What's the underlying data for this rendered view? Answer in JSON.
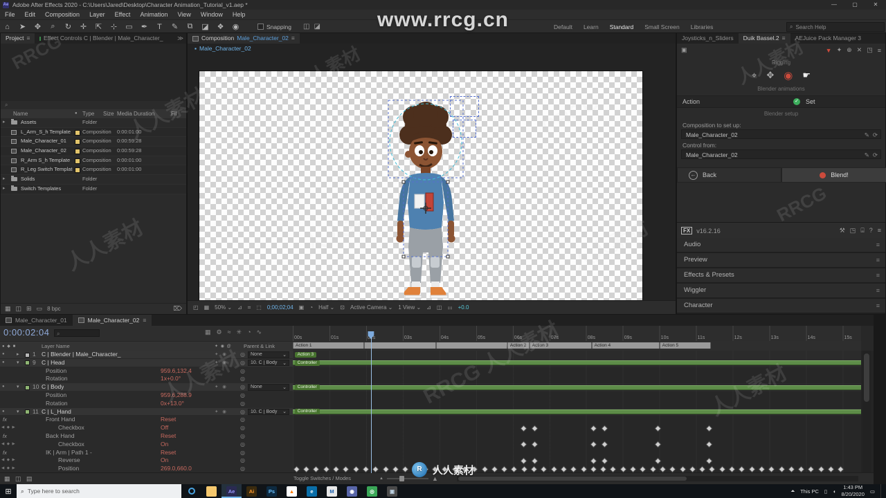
{
  "titlebar": {
    "title": "Adobe After Effects 2020 - C:\\Users\\Jared\\Desktop\\Character Animation_Tutorial_v1.aep *"
  },
  "menubar": {
    "items": [
      "File",
      "Edit",
      "Composition",
      "Layer",
      "Effect",
      "Animation",
      "View",
      "Window",
      "Help"
    ]
  },
  "toolbar": {
    "tools": [
      {
        "name": "home",
        "glyph": "⌂"
      },
      {
        "name": "selection",
        "glyph": "➤"
      },
      {
        "name": "hand",
        "glyph": "✥"
      },
      {
        "name": "zoom",
        "glyph": "⌕"
      },
      {
        "name": "orbit-camera",
        "glyph": "↻"
      },
      {
        "name": "pan-camera",
        "glyph": "✛"
      },
      {
        "name": "dolly-camera",
        "glyph": "⇱"
      },
      {
        "name": "pan-behind",
        "glyph": "⊹"
      },
      {
        "name": "shape",
        "glyph": "▭"
      },
      {
        "name": "pen",
        "glyph": "✒"
      },
      {
        "name": "type",
        "glyph": "T"
      },
      {
        "name": "brush",
        "glyph": "✎"
      },
      {
        "name": "clone-stamp",
        "glyph": "⧉"
      },
      {
        "name": "eraser",
        "glyph": "◪"
      },
      {
        "name": "roto-brush",
        "glyph": "❖"
      },
      {
        "name": "puppet-pin",
        "glyph": "◉"
      }
    ],
    "snapping_label": "Snapping",
    "workspaces": [
      {
        "label": "Default",
        "active": false
      },
      {
        "label": "Learn",
        "active": false
      },
      {
        "label": "Standard",
        "active": true
      },
      {
        "label": "Small Screen",
        "active": false
      },
      {
        "label": "Libraries",
        "active": false
      }
    ],
    "search_placeholder": "Search Help"
  },
  "project": {
    "tab_active": "Project",
    "tab_inactive": "Effect Controls C | Blender | Male_Character_",
    "columns": [
      "Name",
      "Type",
      "Size",
      "Media Duration",
      "Fil"
    ],
    "items": [
      {
        "name": "Assets",
        "type": "Folder",
        "duration": "",
        "icon": "folder",
        "label": ""
      },
      {
        "name": "L_Arm_S_h Template",
        "type": "Composition",
        "duration": "0:00:01:00",
        "icon": "comp",
        "label": "#e2c46b"
      },
      {
        "name": "Male_Character_01",
        "type": "Composition",
        "duration": "0:00:59:28",
        "icon": "comp",
        "label": "#e2c46b"
      },
      {
        "name": "Male_Character_02",
        "type": "Composition",
        "duration": "0:00:59:28",
        "icon": "comp",
        "label": "#e2c46b"
      },
      {
        "name": "R_Arm S_h Template",
        "type": "Composition",
        "duration": "0:00:01:00",
        "icon": "comp",
        "label": "#e2c46b"
      },
      {
        "name": "R_Leg Switch Template",
        "type": "Composition",
        "duration": "0:00:01:00",
        "icon": "comp",
        "label": "#e2c46b"
      },
      {
        "name": "Solids",
        "type": "Folder",
        "duration": "",
        "icon": "folder",
        "label": ""
      },
      {
        "name": "Switch Templates",
        "type": "Folder",
        "duration": "",
        "icon": "folder",
        "label": ""
      }
    ],
    "footer_depth": "8 bpc"
  },
  "composition": {
    "tab_label": "Composition",
    "comp_name": "Male_Character_02",
    "breadcrumb": "Male_Character_02",
    "footer": {
      "zoom": "50%",
      "time": "0;00;02;04",
      "resolution": "Half",
      "camera": "Active Camera",
      "views": "1 View",
      "exposure": "+0.0"
    }
  },
  "right": {
    "tabs": [
      {
        "label": "Joysticks_n_Sliders",
        "active": false
      },
      {
        "label": "Duik Bassel.2",
        "active": true
      },
      {
        "label": "AEJuice Pack Manager 3",
        "active": false
      }
    ],
    "duik": {
      "section_rigging": "Rigging",
      "section_blender": "Blender animations",
      "action_label": "Action",
      "set_label": "Set",
      "setup_caption": "Blender setup",
      "comp_to_setup_label": "Composition to set up:",
      "comp_to_setup_value": "Male_Character_02",
      "control_from_label": "Control from:",
      "control_from_value": "Male_Character_02",
      "back_label": "Back",
      "blend_label": "Blend!"
    },
    "fx": {
      "logo": "FX",
      "version": "v16.2.16"
    },
    "stacked_panels": [
      "Audio",
      "Preview",
      "Effects & Presets",
      "Wiggler",
      "Character"
    ]
  },
  "timeline": {
    "tabs": [
      {
        "label": "Male_Character_01",
        "active": false
      },
      {
        "label": "Male_Character_02",
        "active": true
      }
    ],
    "timecode": "0:00:02:04",
    "search_placeholder": "",
    "columns": {
      "layer_name": "Layer Name",
      "parent": "Parent & Link"
    },
    "ruler": [
      "00s",
      "01s",
      "02s",
      "03s",
      "04s",
      "05s",
      "06s",
      "07s",
      "08s",
      "09s",
      "10s",
      "11s",
      "12s",
      "13s",
      "14s",
      "15s"
    ],
    "ruler_seconds": 15.5,
    "cti_seconds": 2.13,
    "markers": [
      {
        "label": "Action 1",
        "start": 0,
        "end": 1.95
      },
      {
        "label": "",
        "start": 1.95,
        "end": 3.9
      },
      {
        "label": "",
        "start": 3.9,
        "end": 5.85
      },
      {
        "label": "Action 2",
        "start": 5.85,
        "end": 6.45
      },
      {
        "label": "Action 3",
        "start": 6.45,
        "end": 8.15
      },
      {
        "label": "Action 4",
        "start": 8.15,
        "end": 10.0
      },
      {
        "label": "Action 5",
        "start": 10.0,
        "end": 11.4
      }
    ],
    "rows": [
      {
        "kind": "layer",
        "num": "1",
        "name": "C | Blender | Male_Character_",
        "parent": "None",
        "label_color": "#b8b8b8",
        "twirl": "▸",
        "chip": {
          "label": "Action 3",
          "start": 0.05
        }
      },
      {
        "kind": "layer",
        "num": "9",
        "name": "C | Head",
        "parent": "10. C | Body",
        "label_color": "#8fb573",
        "twirl": "▾",
        "bar": {
          "label": "Controller",
          "start": 0,
          "end": 15.5
        }
      },
      {
        "kind": "prop",
        "label": "Position",
        "value": "959.6,132.4"
      },
      {
        "kind": "prop",
        "label": "Rotation",
        "value": "1x+0.0°"
      },
      {
        "kind": "layer",
        "num": "10",
        "name": "C | Body",
        "parent": "None",
        "label_color": "#8fb573",
        "twirl": "▾",
        "bar": {
          "label": "Controller",
          "start": 0,
          "end": 15.5
        }
      },
      {
        "kind": "prop",
        "label": "Position",
        "value": "959.6,288.9"
      },
      {
        "kind": "prop",
        "label": "Rotation",
        "value": "0x+13.0°"
      },
      {
        "kind": "layer",
        "num": "11",
        "name": "C | L_Hand",
        "parent": "10. C | Body",
        "label_color": "#8fb573",
        "twirl": "▾",
        "bar": {
          "label": "Controller",
          "start": 0,
          "end": 15.5
        }
      },
      {
        "kind": "group",
        "label": "Front Hand",
        "value": "Reset",
        "fx": true
      },
      {
        "kind": "sub",
        "label": "Checkbox",
        "value": "Off",
        "keys": [
          6.3,
          6.6,
          8.2,
          8.5,
          9.95,
          11.35
        ]
      },
      {
        "kind": "group",
        "label": "Back Hand",
        "value": "Reset",
        "fx": true
      },
      {
        "kind": "sub",
        "label": "Checkbox",
        "value": "On",
        "keys": [
          6.3,
          6.6,
          8.2,
          8.5,
          9.95,
          11.35
        ]
      },
      {
        "kind": "group",
        "label": "IK | Arm | Path 1 -",
        "value": "Reset",
        "fx": true
      },
      {
        "kind": "sub",
        "label": "Reverse",
        "value": "On",
        "keys": [
          6.3,
          6.6,
          8.2,
          8.5,
          9.95,
          11.35
        ]
      },
      {
        "kind": "sub",
        "label": "Position",
        "value": "269.0,660.0",
        "keys_range": [
          0.1,
          15.2,
          0.27
        ]
      }
    ],
    "footer_toggle": "Toggle Switches / Modes"
  },
  "taskbar": {
    "search_placeholder": "Type here to search",
    "this_pc": "This PC",
    "time": "1:43 PM",
    "date": "8/20/2020",
    "apps": [
      {
        "name": "cortana",
        "color": "#1a2633",
        "glyph": "○"
      },
      {
        "name": "file-explorer",
        "color": "#f5c86e",
        "glyph": ""
      },
      {
        "name": "after-effects",
        "color": "#2a2a52",
        "glyph": "Ae",
        "text": "#9b9bff",
        "active": true
      },
      {
        "name": "illustrator",
        "color": "#3a2a0e",
        "glyph": "Ai",
        "text": "#ff9a2e"
      },
      {
        "name": "photoshop",
        "color": "#0d2a41",
        "glyph": "Ps",
        "text": "#6ec3ff"
      },
      {
        "name": "vlc",
        "color": "#ffffff",
        "glyph": "▲",
        "text": "#ff7a00"
      },
      {
        "name": "edge",
        "color": "#0a6ea8",
        "glyph": "e",
        "text": "#ffffff"
      },
      {
        "name": "maxon",
        "color": "#e8e8e8",
        "glyph": "M",
        "text": "#1a5fae"
      },
      {
        "name": "discord",
        "color": "#5865a8",
        "glyph": "◉",
        "text": "#ffffff"
      },
      {
        "name": "chrome",
        "color": "#3aa757",
        "glyph": "◎",
        "text": "#ffffff"
      },
      {
        "name": "photos",
        "color": "#4a4a4a",
        "glyph": "▣",
        "text": "#bcd0e0"
      }
    ]
  },
  "watermark": {
    "url": "www.rrcg.cn",
    "brand": "人人素材",
    "brand_en": "RRCG",
    "tiles": [
      "RRCG",
      "人人素材",
      "人人素材",
      "RRCG",
      "人人素材",
      "人人素材",
      "人人素材",
      "人人素材",
      "RRCG",
      "人人素材",
      "RRCG 人人素材",
      "人人素材"
    ]
  }
}
